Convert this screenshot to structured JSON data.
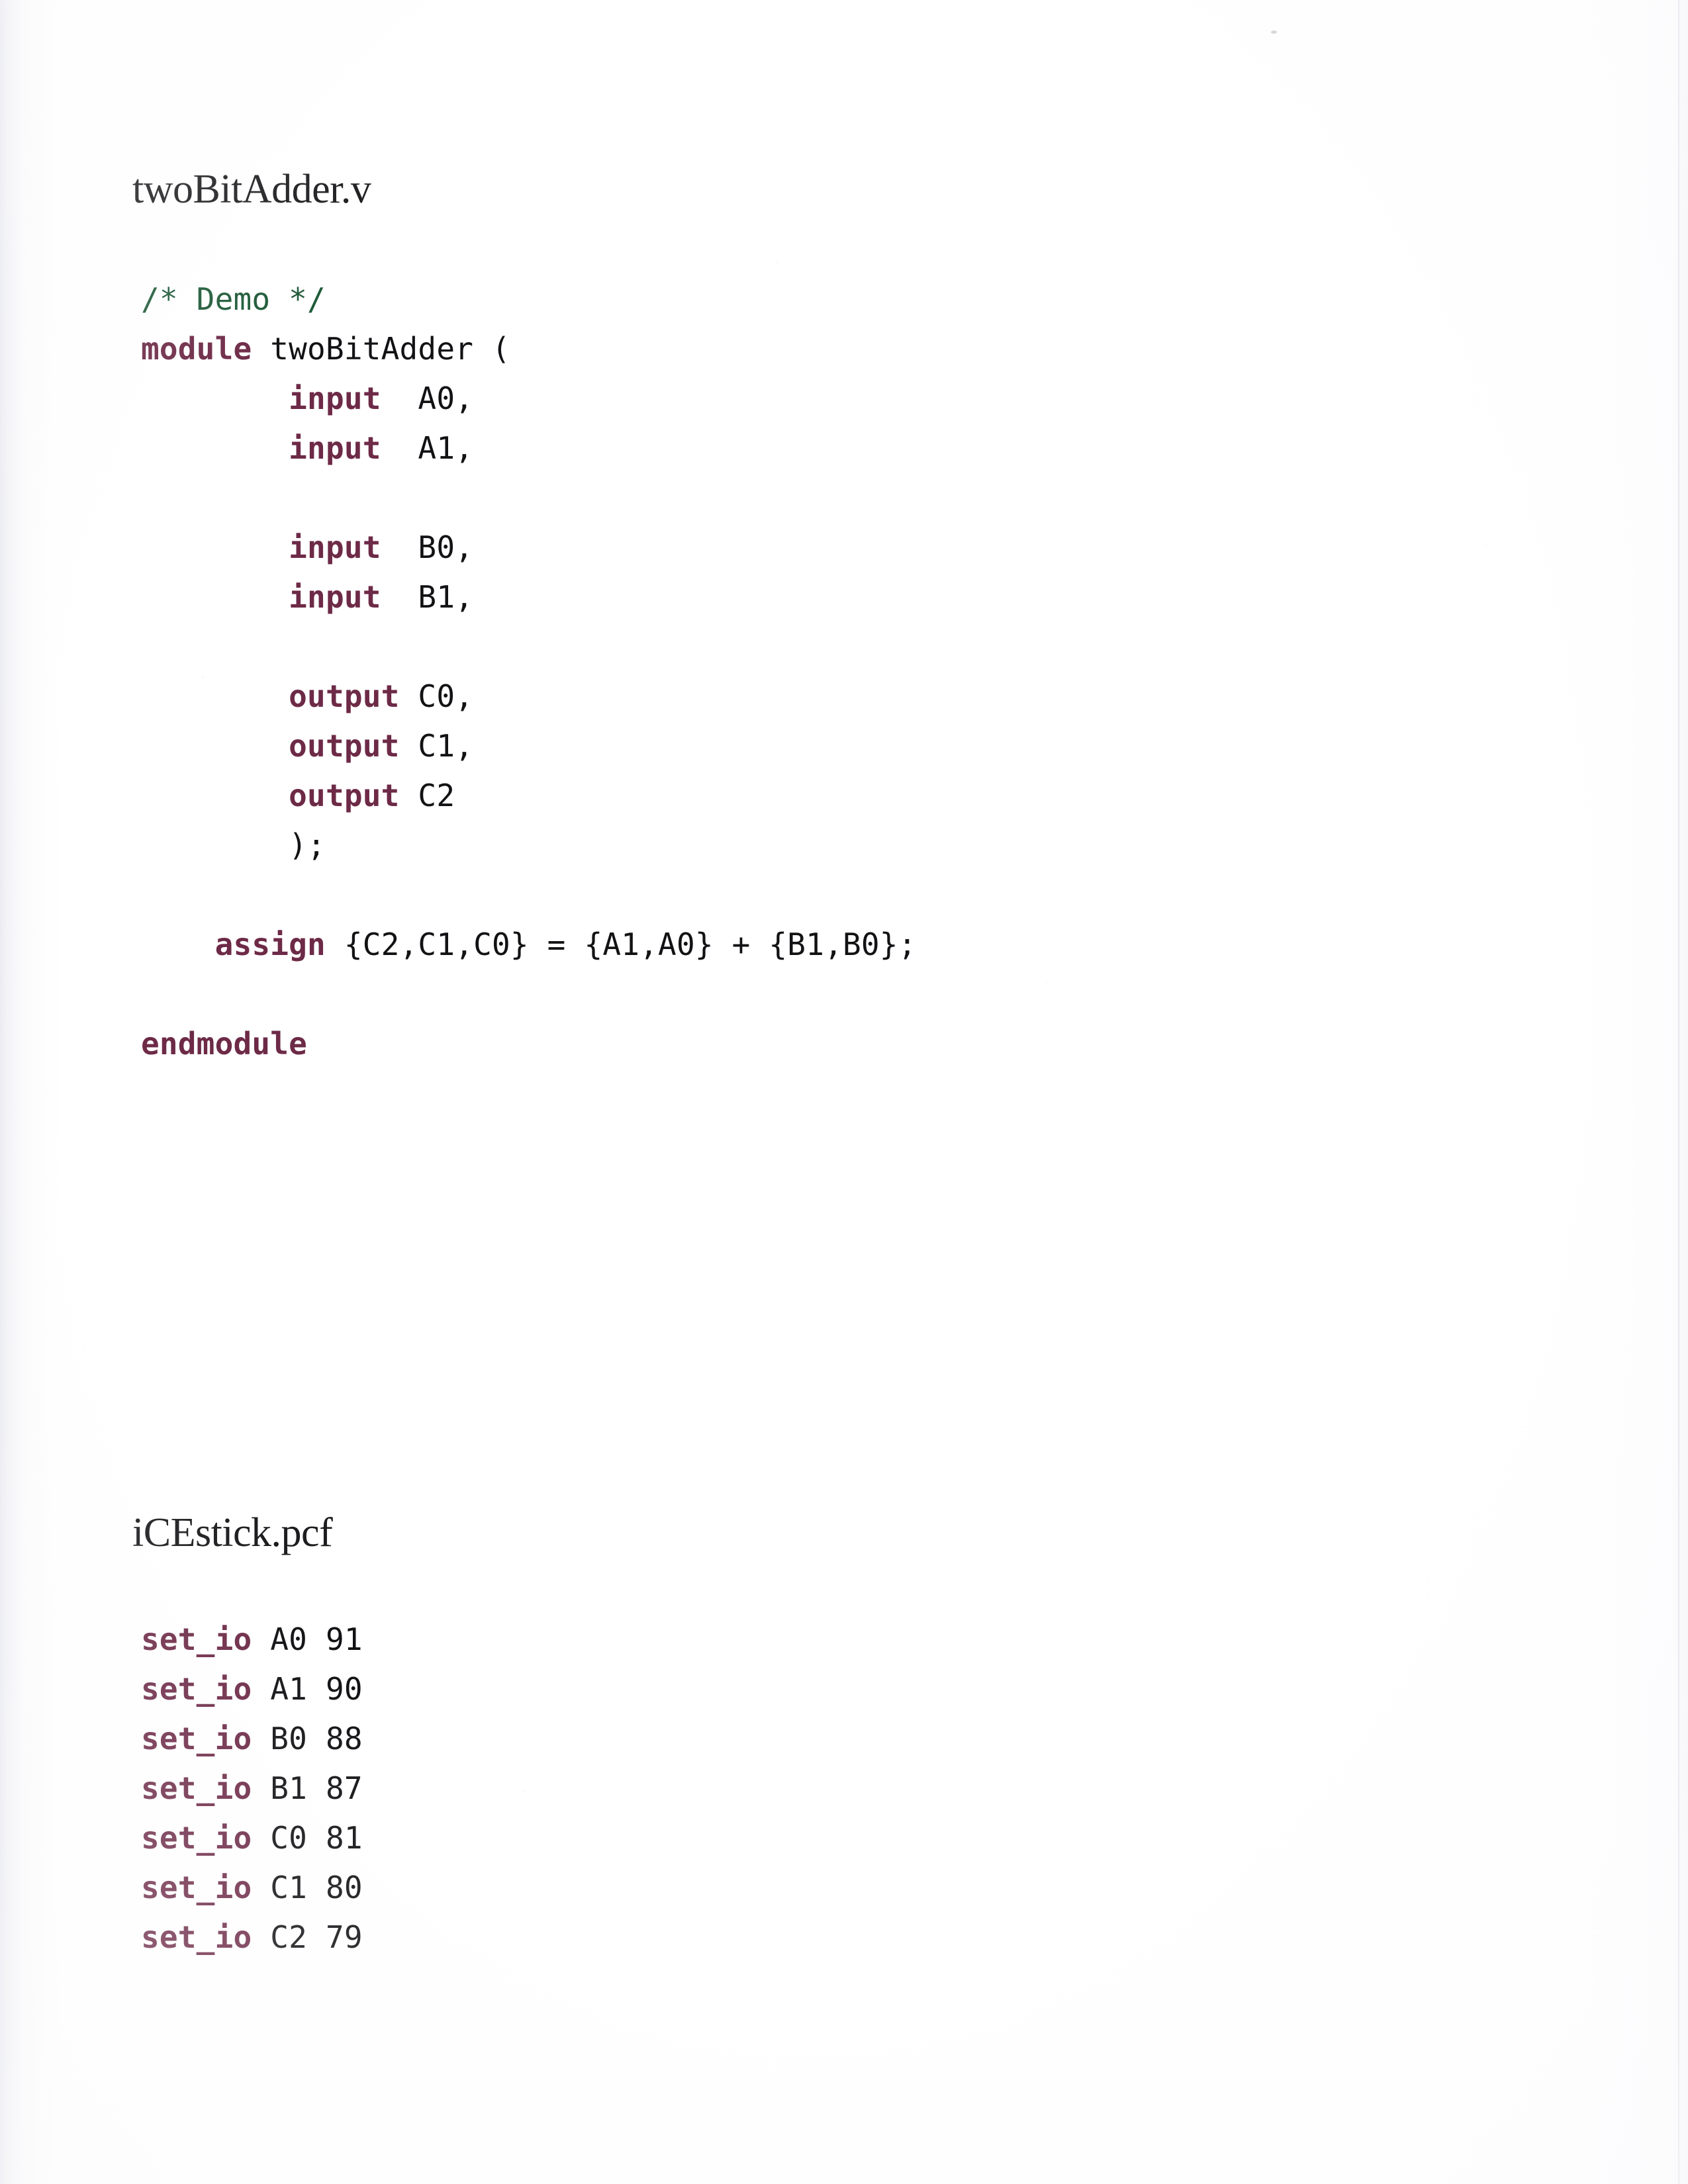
{
  "page": {
    "background_color": "#fefefe",
    "ink_color": "#121114",
    "keyword_color": "#6d2a47",
    "comment_color": "#1f5a38"
  },
  "sections": [
    {
      "heading": "twoBitAdder.v",
      "language": "verilog",
      "lines": [
        {
          "text": "/* Demo */",
          "tokens": [
            {
              "t": "/* Demo */",
              "c": "comment"
            }
          ]
        },
        {
          "text": "module twoBitAdder (",
          "tokens": [
            {
              "t": "module",
              "c": "kw"
            },
            {
              "t": " twoBitAdder (",
              "c": "plain"
            }
          ]
        },
        {
          "text": "        input  A0,",
          "tokens": [
            {
              "t": "        ",
              "c": "plain"
            },
            {
              "t": "input",
              "c": "kw"
            },
            {
              "t": "  A0,",
              "c": "plain"
            }
          ]
        },
        {
          "text": "        input  A1,",
          "tokens": [
            {
              "t": "        ",
              "c": "plain"
            },
            {
              "t": "input",
              "c": "kw"
            },
            {
              "t": "  A1,",
              "c": "plain"
            }
          ]
        },
        {
          "text": "",
          "tokens": []
        },
        {
          "text": "        input  B0,",
          "tokens": [
            {
              "t": "        ",
              "c": "plain"
            },
            {
              "t": "input",
              "c": "kw"
            },
            {
              "t": "  B0,",
              "c": "plain"
            }
          ]
        },
        {
          "text": "        input  B1,",
          "tokens": [
            {
              "t": "        ",
              "c": "plain"
            },
            {
              "t": "input",
              "c": "kw"
            },
            {
              "t": "  B1,",
              "c": "plain"
            }
          ]
        },
        {
          "text": "",
          "tokens": []
        },
        {
          "text": "        output C0,",
          "tokens": [
            {
              "t": "        ",
              "c": "plain"
            },
            {
              "t": "output",
              "c": "kw"
            },
            {
              "t": " C0,",
              "c": "plain"
            }
          ]
        },
        {
          "text": "        output C1,",
          "tokens": [
            {
              "t": "        ",
              "c": "plain"
            },
            {
              "t": "output",
              "c": "kw"
            },
            {
              "t": " C1,",
              "c": "plain"
            }
          ]
        },
        {
          "text": "        output C2",
          "tokens": [
            {
              "t": "        ",
              "c": "plain"
            },
            {
              "t": "output",
              "c": "kw"
            },
            {
              "t": " C2",
              "c": "plain"
            }
          ]
        },
        {
          "text": "        );",
          "tokens": [
            {
              "t": "        );",
              "c": "plain"
            }
          ]
        },
        {
          "text": "",
          "tokens": []
        },
        {
          "text": "    assign {C2,C1,C0} = {A1,A0} + {B1,B0};",
          "tokens": [
            {
              "t": "    ",
              "c": "plain"
            },
            {
              "t": "assign",
              "c": "kw"
            },
            {
              "t": " {C2,C1,C0} = {A1,A0} + {B1,B0};",
              "c": "plain"
            }
          ]
        },
        {
          "text": "",
          "tokens": []
        },
        {
          "text": "endmodule",
          "tokens": [
            {
              "t": "endmodule",
              "c": "kw"
            }
          ]
        }
      ]
    },
    {
      "heading": "iCEstick.pcf",
      "language": "pcf",
      "lines": [
        {
          "text": "set_io A0 91",
          "tokens": [
            {
              "t": "set_io",
              "c": "kw"
            },
            {
              "t": " A0 91",
              "c": "plain"
            }
          ]
        },
        {
          "text": "set_io A1 90",
          "tokens": [
            {
              "t": "set_io",
              "c": "kw"
            },
            {
              "t": " A1 90",
              "c": "plain"
            }
          ]
        },
        {
          "text": "set_io B0 88",
          "tokens": [
            {
              "t": "set_io",
              "c": "kw"
            },
            {
              "t": " B0 88",
              "c": "plain"
            }
          ]
        },
        {
          "text": "set_io B1 87",
          "tokens": [
            {
              "t": "set_io",
              "c": "kw"
            },
            {
              "t": " B1 87",
              "c": "plain"
            }
          ]
        },
        {
          "text": "set_io C0 81",
          "tokens": [
            {
              "t": "set_io",
              "c": "kw"
            },
            {
              "t": " C0 81",
              "c": "plain"
            }
          ]
        },
        {
          "text": "set_io C1 80",
          "tokens": [
            {
              "t": "set_io",
              "c": "kw"
            },
            {
              "t": " C1 80",
              "c": "plain"
            }
          ]
        },
        {
          "text": "set_io C2 79",
          "tokens": [
            {
              "t": "set_io",
              "c": "kw"
            },
            {
              "t": " C2 79",
              "c": "plain"
            }
          ]
        }
      ]
    }
  ]
}
